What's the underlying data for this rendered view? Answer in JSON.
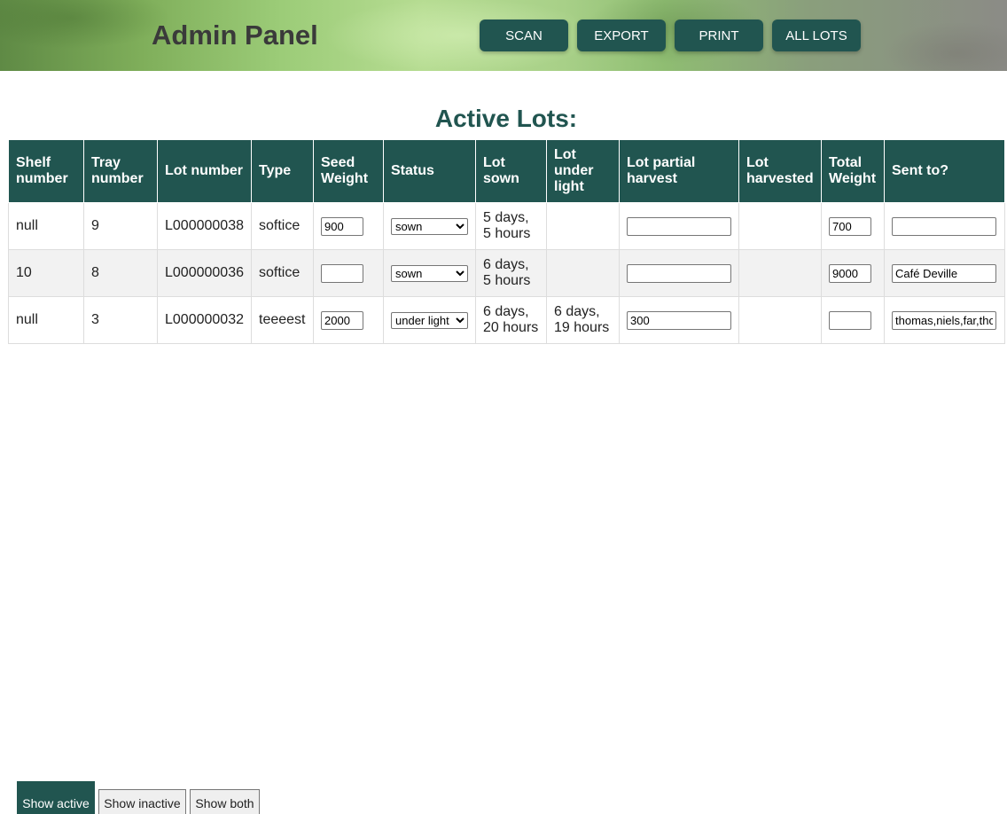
{
  "header": {
    "title": "Admin Panel",
    "nav": [
      {
        "label": "SCAN"
      },
      {
        "label": "EXPORT"
      },
      {
        "label": "PRINT"
      },
      {
        "label": "ALL LOTS"
      }
    ]
  },
  "section_title": "Active Lots:",
  "table": {
    "columns": [
      "Shelf number",
      "Tray number",
      "Lot number",
      "Type",
      "Seed Weight",
      "Status",
      "Lot sown",
      "Lot under light",
      "Lot partial harvest",
      "Lot harvested",
      "Total Weight",
      "Sent to?"
    ],
    "status_options": [
      "sown",
      "under light"
    ],
    "rows": [
      {
        "shelf": "null",
        "tray": "9",
        "lot": "L000000038",
        "type": "softice",
        "seed_weight": "900",
        "status": "sown",
        "sown": "5 days, 5 hours",
        "under_light": "",
        "partial_harvest": "",
        "harvested": "",
        "total_weight": "700",
        "sent_to": ""
      },
      {
        "shelf": "10",
        "tray": "8",
        "lot": "L000000036",
        "type": "softice",
        "seed_weight": "",
        "status": "sown",
        "sown": "6 days, 5 hours",
        "under_light": "",
        "partial_harvest": "",
        "harvested": "",
        "total_weight": "9000",
        "sent_to": "Café Deville"
      },
      {
        "shelf": "null",
        "tray": "3",
        "lot": "L000000032",
        "type": "teeeest",
        "seed_weight": "2000",
        "status": "under light",
        "sown": "6 days, 20 hours",
        "under_light": "6 days, 19 hours",
        "partial_harvest": "300",
        "harvested": "",
        "total_weight": "",
        "sent_to": "thomas,niels,far,thomas"
      }
    ]
  },
  "filters": {
    "show_active": "Show active",
    "show_inactive": "Show inactive",
    "show_both": "Show both"
  },
  "colors": {
    "primary": "#215550",
    "row_alt": "#f2f2f2"
  }
}
